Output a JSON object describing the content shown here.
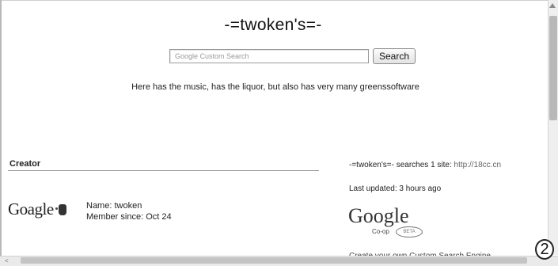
{
  "header": {
    "title": "-=twoken's=-"
  },
  "search": {
    "placeholder": "Google Custom Search",
    "button_label": "Search"
  },
  "tagline": "Here has the music, has the liquor, but also has very many greenssoftware",
  "creator": {
    "heading": "Creator",
    "logo_text": "Goagle",
    "name": "Name: twoken",
    "member_since": "Member since: Oct 24"
  },
  "info": {
    "searches_text": "-=twoken's=- searches 1 site:",
    "site_url": "http://18cc.cn",
    "updated": "Last updated: 3 hours ago",
    "coop_logo": "Google",
    "coop_sub": "Co-op",
    "coop_badge": "BETA",
    "create_text": "Create your own Custom Search Engine"
  },
  "scroll": {
    "left_arrow": "<"
  },
  "badge": "2",
  "colors": {
    "background": "#ffffff",
    "text": "#222222",
    "rule": "#9b9b9b"
  }
}
